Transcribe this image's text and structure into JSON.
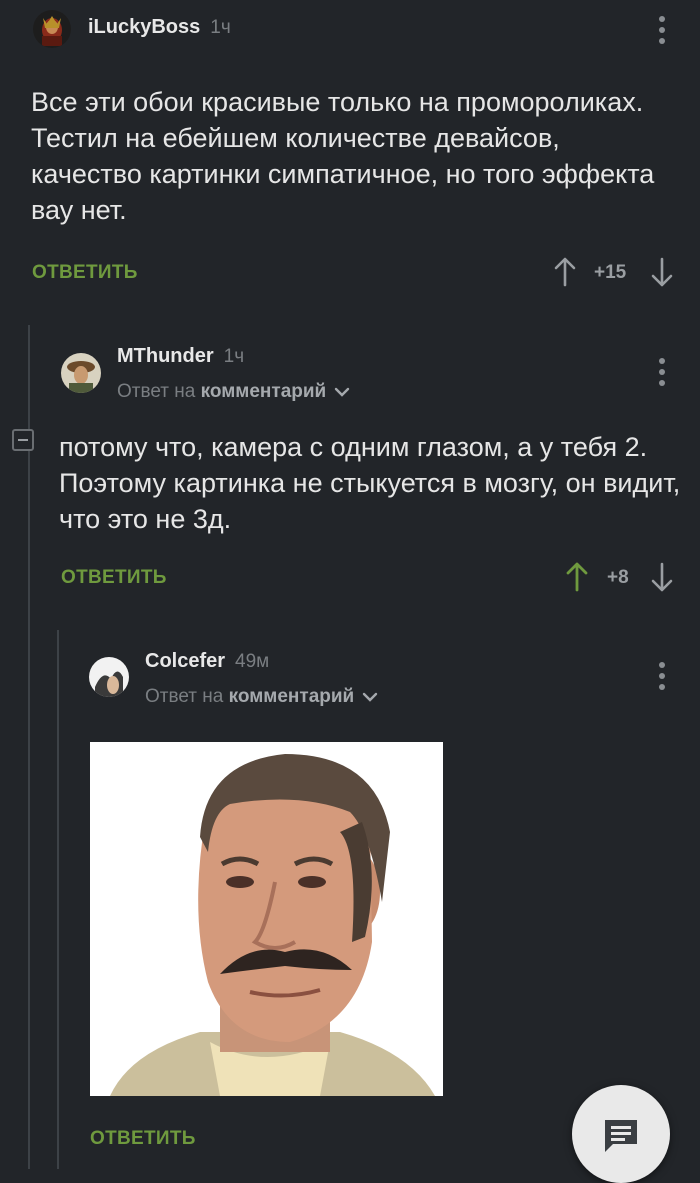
{
  "comments": [
    {
      "username": "iLuckyBoss",
      "time": "1ч",
      "text": "Все эти обои красивые только на промороликах. Тестил на ебейшем количестве девайсов, качество картинки симпатичное, но того эффекта вау нет.",
      "reply_label": "ОТВЕТИТЬ",
      "score": "+15"
    },
    {
      "username": "MThunder",
      "time": "1ч",
      "reply_prefix": "Ответ на",
      "reply_target": "комментарий",
      "text": "потому что, камера с одним глазом, а у тебя 2. Поэтому картинка не стыкуется в мозгу, он видит, что это не 3д.",
      "reply_label": "ОТВЕТИТЬ",
      "score": "+8"
    },
    {
      "username": "Colcefer",
      "time": "49м",
      "reply_prefix": "Ответ на",
      "reply_target": "комментарий",
      "image": "meme-face-image",
      "reply_label": "ОТВЕТИТЬ"
    }
  ],
  "icons": {
    "upvote": "arrow-up-icon",
    "downvote": "arrow-down-icon",
    "menu": "kebab-icon",
    "collapse": "collapse-icon",
    "chevron": "chevron-down-icon",
    "fab": "comment-icon"
  },
  "colors": {
    "background": "#222529",
    "accent_green": "#6f9a3e",
    "text": "#e6e6e6",
    "muted": "#7a7e82"
  }
}
